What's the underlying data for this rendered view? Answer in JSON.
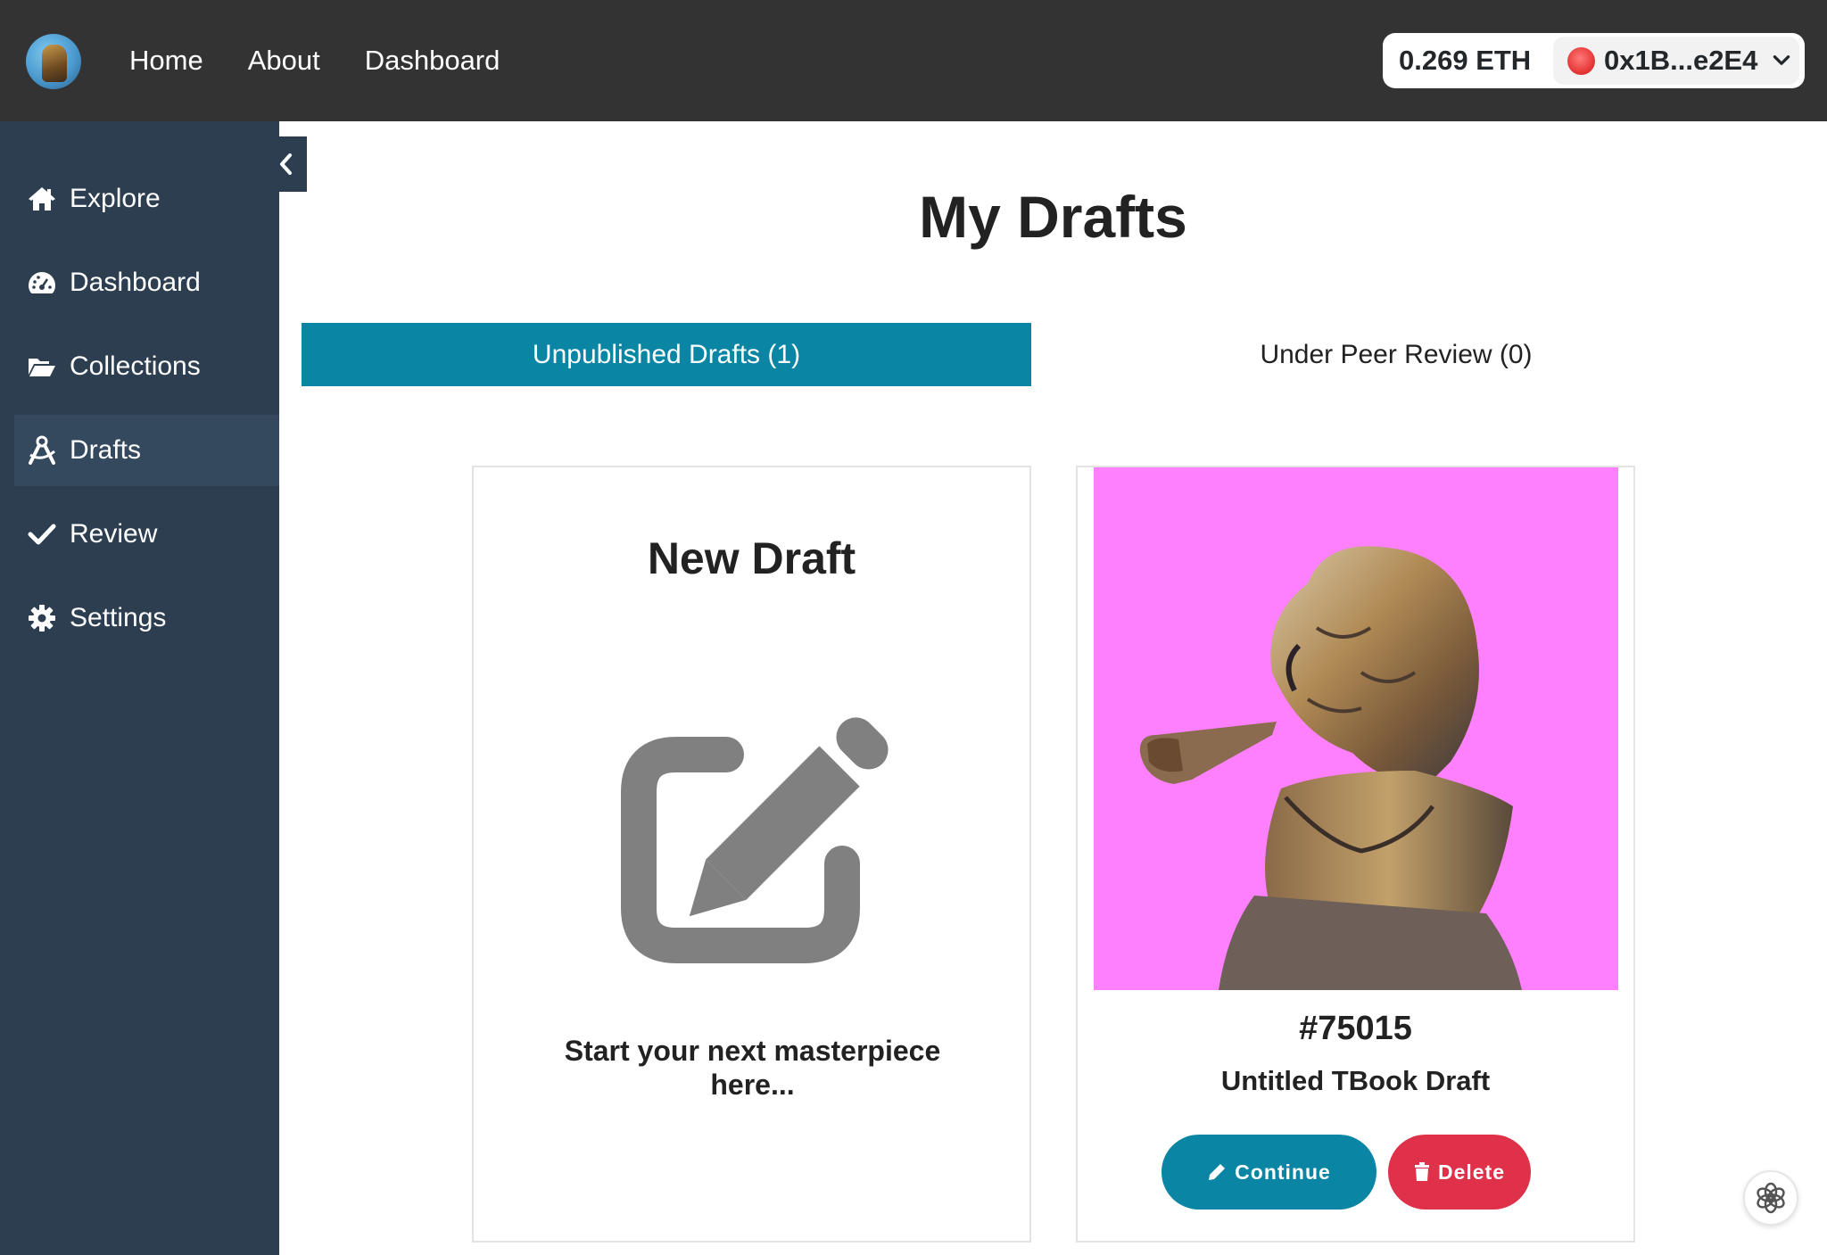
{
  "nav": {
    "links": [
      "Home",
      "About",
      "Dashboard"
    ],
    "balance": "0.269 ETH",
    "account": "0x1B...e2E4"
  },
  "sidebar": {
    "items": [
      {
        "label": "Explore",
        "icon": "home-icon"
      },
      {
        "label": "Dashboard",
        "icon": "speedometer-icon"
      },
      {
        "label": "Collections",
        "icon": "folder-open-icon"
      },
      {
        "label": "Drafts",
        "icon": "drafting-compass-icon",
        "active": true
      },
      {
        "label": "Review",
        "icon": "check-icon"
      },
      {
        "label": "Settings",
        "icon": "gear-icon"
      }
    ]
  },
  "page": {
    "title": "My Drafts",
    "tabs": [
      "Unpublished Drafts (1)",
      "Under Peer Review (0)"
    ]
  },
  "new_draft": {
    "title": "New Draft",
    "text": "Start your next masterpiece here..."
  },
  "draft": {
    "number": "#75015",
    "name": "Untitled TBook Draft",
    "continue_label": "Continue",
    "delete_label": "Delete"
  },
  "colors": {
    "topbar": "#333333",
    "sidebar": "#2c3e50",
    "accent": "#0a85a4",
    "danger": "#e0314b",
    "art_background": "#ff80ff"
  }
}
